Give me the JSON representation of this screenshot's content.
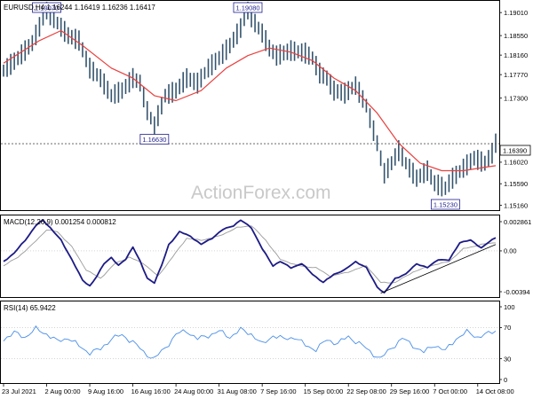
{
  "main_panel": {
    "title": "EURUSD,H4  1.16244 1.16419 1.16236 1.16417",
    "watermark": "ActionForex.com",
    "current_price": "1.16390",
    "y_ticks": [
      "1.19010",
      "1.18550",
      "1.18160",
      "1.17770",
      "1.17300",
      "1.16390",
      "1.16020",
      "1.15590",
      "1.15160"
    ],
    "annotations": [
      {
        "label": "1.19070"
      },
      {
        "label": "1.19080"
      },
      {
        "label": "1.16630"
      },
      {
        "label": "1.15230"
      }
    ]
  },
  "macd_panel": {
    "title": "MACD(12,26,9) 0.001254 0.000812",
    "y_ticks": [
      "0.002861",
      "0.00",
      "-0.00394"
    ]
  },
  "rsi_panel": {
    "title": "RSI(14) 65.9422",
    "y_ticks": [
      "100",
      "70",
      "30",
      "0"
    ]
  },
  "x_ticks": [
    "23 Jul 2021",
    "2 Aug 00:00",
    "9 Aug 16:00",
    "16 Aug 16:00",
    "24 Aug 00:00",
    "31 Aug 08:00",
    "7 Sep 16:00",
    "15 Sep 00:00",
    "22 Sep 08:00",
    "29 Sep 16:00",
    "7 Oct 00:00",
    "14 Oct 08:00"
  ],
  "colors": {
    "candles": "#34546e",
    "ma": "#e8423f",
    "macd": "#1d1b86",
    "signal": "#9a9a9a",
    "rsi": "#4a8fe8",
    "trendline": "#000000",
    "annotation_border": "#1f1f8f",
    "annotation_text": "#1f1f8f"
  },
  "chart_data": {
    "type": "line",
    "main": {
      "price_path": [
        [
          0,
          1.1785
        ],
        [
          4,
          1.181
        ],
        [
          8,
          1.184
        ],
        [
          12,
          1.1905
        ],
        [
          15,
          1.188
        ],
        [
          18,
          1.1855
        ],
        [
          21,
          1.1845
        ],
        [
          24,
          1.179
        ],
        [
          27,
          1.177
        ],
        [
          30,
          1.1735
        ],
        [
          33,
          1.1745
        ],
        [
          36,
          1.177
        ],
        [
          38,
          1.176
        ],
        [
          40,
          1.1705
        ],
        [
          42,
          1.1675
        ],
        [
          45,
          1.1735
        ],
        [
          48,
          1.1745
        ],
        [
          51,
          1.177
        ],
        [
          54,
          1.176
        ],
        [
          57,
          1.179
        ],
        [
          60,
          1.181
        ],
        [
          63,
          1.1835
        ],
        [
          66,
          1.187
        ],
        [
          68,
          1.1905
        ],
        [
          70,
          1.188
        ],
        [
          72,
          1.186
        ],
        [
          74,
          1.183
        ],
        [
          76,
          1.1815
        ],
        [
          80,
          1.1825
        ],
        [
          84,
          1.182
        ],
        [
          86,
          1.181
        ],
        [
          88,
          1.178
        ],
        [
          90,
          1.177
        ],
        [
          92,
          1.1745
        ],
        [
          95,
          1.174
        ],
        [
          98,
          1.1755
        ],
        [
          101,
          1.1715
        ],
        [
          104,
          1.164
        ],
        [
          106,
          1.158
        ],
        [
          108,
          1.16
        ],
        [
          110,
          1.1625
        ],
        [
          112,
          1.16
        ],
        [
          115,
          1.157
        ],
        [
          118,
          1.1585
        ],
        [
          120,
          1.156
        ],
        [
          123,
          1.155
        ],
        [
          125,
          1.157
        ],
        [
          128,
          1.159
        ],
        [
          131,
          1.161
        ],
        [
          134,
          1.16
        ],
        [
          136,
          1.162
        ],
        [
          137,
          1.164
        ]
      ],
      "ma_path": [
        [
          0,
          1.18
        ],
        [
          10,
          1.1845
        ],
        [
          16,
          1.1865
        ],
        [
          22,
          1.1835
        ],
        [
          30,
          1.179
        ],
        [
          36,
          1.177
        ],
        [
          42,
          1.1735
        ],
        [
          48,
          1.1725
        ],
        [
          55,
          1.1745
        ],
        [
          62,
          1.179
        ],
        [
          68,
          1.1815
        ],
        [
          74,
          1.183
        ],
        [
          80,
          1.1822
        ],
        [
          86,
          1.1805
        ],
        [
          92,
          1.177
        ],
        [
          98,
          1.1745
        ],
        [
          104,
          1.17
        ],
        [
          110,
          1.164
        ],
        [
          116,
          1.16
        ],
        [
          122,
          1.1585
        ],
        [
          128,
          1.1585
        ],
        [
          134,
          1.1592
        ],
        [
          137,
          1.1595
        ]
      ],
      "ylim": [
        1.1508,
        1.1919
      ],
      "last": 1.1639
    },
    "macd": {
      "macd_path": [
        [
          0,
          -0.001
        ],
        [
          3,
          -0.0002
        ],
        [
          6,
          0.001
        ],
        [
          9,
          0.0024
        ],
        [
          11,
          0.0029
        ],
        [
          13,
          0.0022
        ],
        [
          16,
          0.001
        ],
        [
          19,
          -0.0008
        ],
        [
          22,
          -0.0028
        ],
        [
          24,
          -0.0033
        ],
        [
          26,
          -0.0024
        ],
        [
          28,
          -0.0012
        ],
        [
          30,
          -0.0006
        ],
        [
          32,
          -0.0014
        ],
        [
          34,
          -0.0008
        ],
        [
          36,
          0.0004
        ],
        [
          38,
          -0.001
        ],
        [
          40,
          -0.0026
        ],
        [
          42,
          -0.003
        ],
        [
          44,
          -0.0014
        ],
        [
          46,
          0.0006
        ],
        [
          49,
          0.0018
        ],
        [
          52,
          0.0014
        ],
        [
          55,
          0.0006
        ],
        [
          58,
          0.0012
        ],
        [
          61,
          0.002
        ],
        [
          64,
          0.0024
        ],
        [
          66,
          0.0029
        ],
        [
          69,
          0.0022
        ],
        [
          72,
          0.0002
        ],
        [
          75,
          -0.0014
        ],
        [
          77,
          -0.001
        ],
        [
          80,
          -0.0016
        ],
        [
          83,
          -0.0012
        ],
        [
          86,
          -0.0022
        ],
        [
          89,
          -0.003
        ],
        [
          92,
          -0.0022
        ],
        [
          95,
          -0.0018
        ],
        [
          98,
          -0.001
        ],
        [
          101,
          -0.0016
        ],
        [
          104,
          -0.0034
        ],
        [
          106,
          -0.004
        ],
        [
          109,
          -0.0026
        ],
        [
          112,
          -0.0022
        ],
        [
          115,
          -0.0012
        ],
        [
          118,
          -0.0016
        ],
        [
          121,
          -0.0008
        ],
        [
          124,
          -0.0009
        ],
        [
          127,
          0.0008
        ],
        [
          130,
          0.001
        ],
        [
          133,
          0.0003
        ],
        [
          135,
          0.0008
        ],
        [
          137,
          0.00125
        ]
      ],
      "signal_path": [
        [
          0,
          -0.0014
        ],
        [
          4,
          -0.0006
        ],
        [
          8,
          0.0006
        ],
        [
          12,
          0.002
        ],
        [
          15,
          0.0018
        ],
        [
          19,
          0.0004
        ],
        [
          23,
          -0.0018
        ],
        [
          27,
          -0.0026
        ],
        [
          31,
          -0.0012
        ],
        [
          35,
          -0.0006
        ],
        [
          39,
          -0.0012
        ],
        [
          43,
          -0.0024
        ],
        [
          47,
          -0.0006
        ],
        [
          51,
          0.0012
        ],
        [
          55,
          0.001
        ],
        [
          60,
          0.0014
        ],
        [
          65,
          0.0022
        ],
        [
          69,
          0.0024
        ],
        [
          73,
          0.001
        ],
        [
          77,
          -0.0008
        ],
        [
          82,
          -0.0014
        ],
        [
          87,
          -0.0016
        ],
        [
          91,
          -0.0024
        ],
        [
          96,
          -0.002
        ],
        [
          101,
          -0.0014
        ],
        [
          105,
          -0.003
        ],
        [
          109,
          -0.003
        ],
        [
          114,
          -0.002
        ],
        [
          119,
          -0.0014
        ],
        [
          124,
          -0.001
        ],
        [
          128,
          0.0002
        ],
        [
          133,
          0.0006
        ],
        [
          137,
          0.0008
        ]
      ],
      "trendline": [
        [
          105,
          -0.004
        ],
        [
          137,
          0.0006
        ]
      ],
      "ylim": [
        -0.0042,
        0.0031
      ]
    },
    "rsi": {
      "rsi_path": [
        [
          0,
          55
        ],
        [
          3,
          63
        ],
        [
          6,
          58
        ],
        [
          9,
          68
        ],
        [
          12,
          62
        ],
        [
          15,
          52
        ],
        [
          18,
          57
        ],
        [
          21,
          46
        ],
        [
          24,
          38
        ],
        [
          27,
          42
        ],
        [
          30,
          56
        ],
        [
          33,
          60
        ],
        [
          36,
          52
        ],
        [
          39,
          38
        ],
        [
          42,
          30
        ],
        [
          45,
          44
        ],
        [
          48,
          61
        ],
        [
          51,
          66
        ],
        [
          54,
          55
        ],
        [
          57,
          60
        ],
        [
          60,
          65
        ],
        [
          63,
          58
        ],
        [
          66,
          67
        ],
        [
          69,
          62
        ],
        [
          72,
          48
        ],
        [
          75,
          60
        ],
        [
          78,
          55
        ],
        [
          81,
          58
        ],
        [
          84,
          47
        ],
        [
          87,
          42
        ],
        [
          90,
          54
        ],
        [
          93,
          50
        ],
        [
          96,
          58
        ],
        [
          99,
          50
        ],
        [
          102,
          39
        ],
        [
          105,
          30
        ],
        [
          108,
          44
        ],
        [
          111,
          56
        ],
        [
          114,
          47
        ],
        [
          117,
          38
        ],
        [
          120,
          48
        ],
        [
          123,
          40
        ],
        [
          126,
          56
        ],
        [
          129,
          64
        ],
        [
          132,
          58
        ],
        [
          135,
          62
        ],
        [
          137,
          66
        ]
      ],
      "ylim": [
        0,
        100
      ],
      "levels": [
        70,
        30
      ]
    },
    "x_tick_index": [
      0,
      12,
      24,
      36,
      48,
      60,
      72,
      84,
      96,
      108,
      120,
      132
    ],
    "n": 138
  }
}
